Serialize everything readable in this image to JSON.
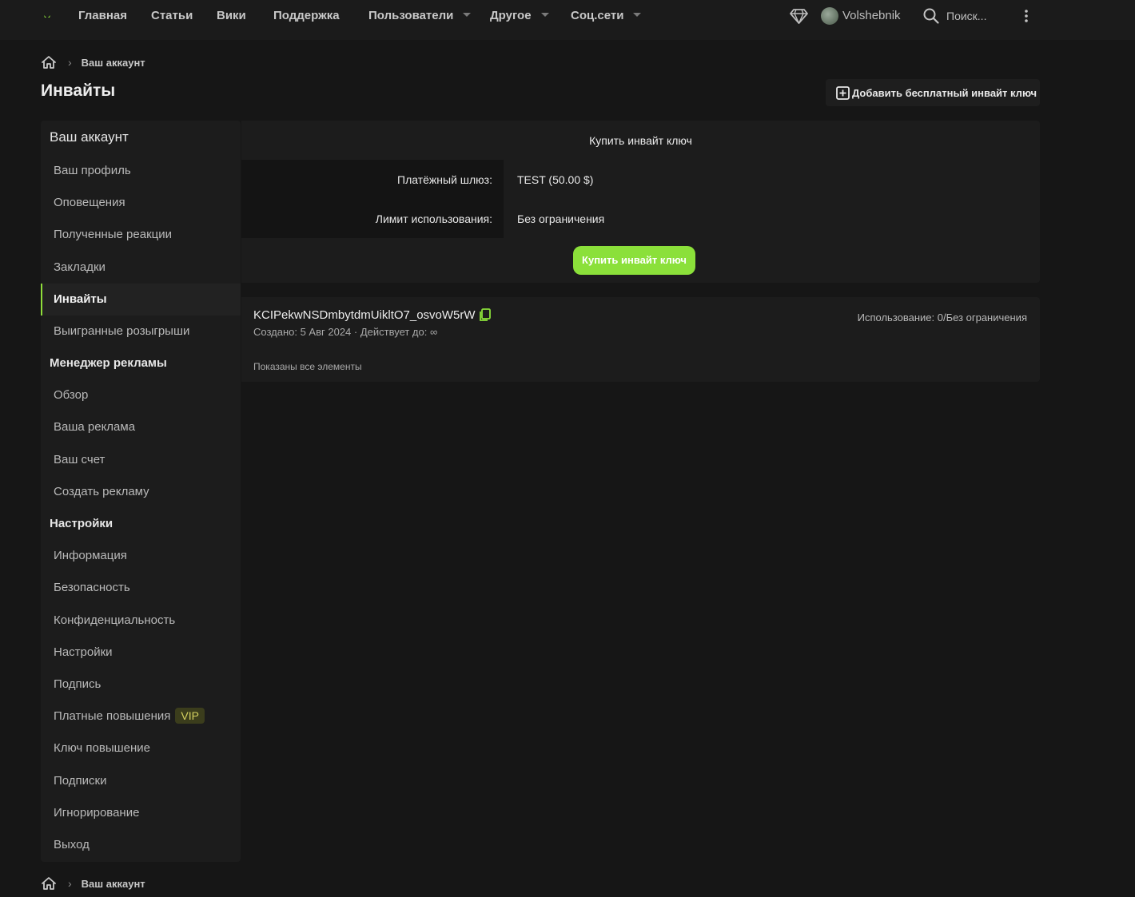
{
  "nav": {
    "items": [
      "Главная",
      "Статьи",
      "Вики",
      "Поддержка",
      "Пользователи",
      "Другое",
      "Соц.сети"
    ],
    "username": "Volshebnik",
    "search_placeholder": "Поиск..."
  },
  "breadcrumb": {
    "label": "Ваш аккаунт"
  },
  "page": {
    "title": "Инвайты",
    "add_free_label": "Добавить бесплатный инвайт ключ"
  },
  "sidebar": {
    "heading": "Ваш аккаунт",
    "account_items": [
      "Ваш профиль",
      "Оповещения",
      "Полученные реакции",
      "Закладки",
      "Инвайты",
      "Выигранные розыгрыши"
    ],
    "active_item": "Инвайты",
    "ads_heading": "Менеджер рекламы",
    "ads_items": [
      "Обзор",
      "Ваша реклама",
      "Ваш счет",
      "Создать рекламу"
    ],
    "settings_heading": "Настройки",
    "settings_items": [
      "Информация",
      "Безопасность",
      "Конфиденциальность",
      "Настройки",
      "Подпись",
      "Платные повышения",
      "Ключ повышение",
      "Подписки",
      "Игнорирование",
      "Выход"
    ],
    "vip_badge": "VIP"
  },
  "buy": {
    "title": "Купить инвайт ключ",
    "gateway_label": "Платёжный шлюз:",
    "gateway_value": "TEST (50.00 $)",
    "limit_label": "Лимит использования:",
    "limit_value": "Без ограничения",
    "button_label": "Купить инвайт ключ"
  },
  "key": {
    "code": "KCIPekwNSDmbytdmUikltO7_osvoW5rW",
    "meta": "Создано: 5 Авг 2024 · Действует до: ∞",
    "usage": "Использование: 0/Без ограничения",
    "all_shown": "Показаны все элементы"
  },
  "colors": {
    "accent": "#8be03a",
    "background": "#161616",
    "panel": "#1c1c1c"
  }
}
